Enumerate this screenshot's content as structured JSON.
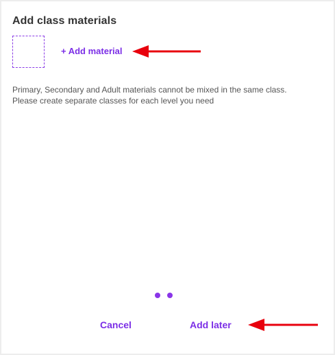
{
  "dialog": {
    "title": "Add class materials",
    "add_material_label": "+ Add material",
    "notice_line1": "Primary, Secondary and Adult materials cannot be mixed in the same class.",
    "notice_line2": "Please create separate classes for each level you need",
    "cancel_label": "Cancel",
    "add_later_label": "Add later"
  },
  "pagination": {
    "total_steps": 2
  },
  "colors": {
    "accent": "#7b2ee6",
    "annotation_arrow": "#e8000d"
  }
}
